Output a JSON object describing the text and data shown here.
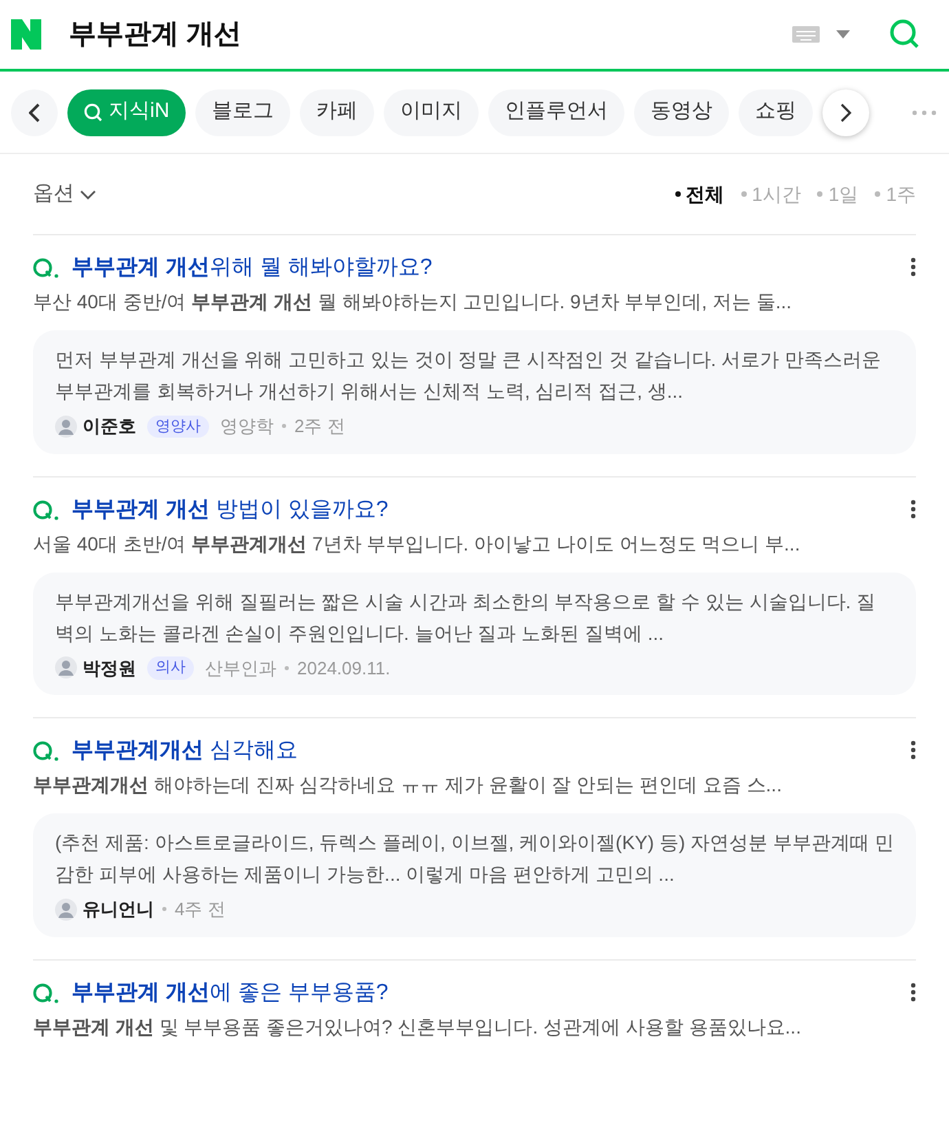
{
  "search": {
    "query": "부부관계 개선"
  },
  "tabs": [
    {
      "label": "지식iN",
      "selected": true
    },
    {
      "label": "블로그",
      "selected": false
    },
    {
      "label": "카페",
      "selected": false
    },
    {
      "label": "이미지",
      "selected": false
    },
    {
      "label": "인플루언서",
      "selected": false
    },
    {
      "label": "동영상",
      "selected": false
    },
    {
      "label": "쇼핑",
      "selected": false
    }
  ],
  "options": {
    "label": "옵션"
  },
  "periods": [
    {
      "label": "전체",
      "selected": true
    },
    {
      "label": "1시간",
      "selected": false
    },
    {
      "label": "1일",
      "selected": false
    },
    {
      "label": "1주",
      "selected": false
    }
  ],
  "results": [
    {
      "title": "**부부관계 개선**위해 뭘 해봐야할까요?",
      "snippet": "부산 40대 중반/여 **부부관계 개선** 뭘 해봐야하는지 고민입니다. 9년차 부부인데, 저는 둘...",
      "answer": {
        "text": "먼저 부부관계 개선을 위해 고민하고 있는 것이 정말 큰 시작점인 것 같습니다. 서로가 만족스러운 부부관계를 회복하거나 개선하기 위해서는 신체적 노력, 심리적 접근, 생...",
        "author": "이준호",
        "badge": "영양사",
        "field": "영양학",
        "time": "2주 전"
      }
    },
    {
      "title": "**부부관계 개선** 방법이 있을까요?",
      "snippet": "서울 40대 초반/여 **부부관계개선** 7년차 부부입니다. 아이낳고 나이도 어느정도 먹으니 부...",
      "answer": {
        "text": "부부관계개선을 위해 질필러는 짧은 시술 시간과 최소한의 부작용으로 할 수 있는 시술입니다. 질 벽의 노화는 콜라겐 손실이 주원인입니다. 늘어난 질과 노화된 질벽에 ...",
        "author": "박정원",
        "badge": "의사",
        "field": "산부인과",
        "time": "2024.09.11."
      }
    },
    {
      "title": "**부부관계개선** 심각해요",
      "snippet": "**부부관계개선** 해야하는데 진짜 심각하네요 ㅠㅠ 제가 윤활이 잘 안되는 편인데 요즘 스...",
      "answer": {
        "text": "(추천 제품: 아스트로글라이드, 듀렉스 플레이, 이브젤, 케이와이젤(KY) 등) 자연성분 부부관계때 민감한 피부에 사용하는 제품이니 가능한... 이렇게 마음 편안하게 고민의 ...",
        "author": "유니언니",
        "time": "4주 전"
      }
    },
    {
      "title": "**부부관계 개선**에 좋은 부부용품?",
      "snippet": "**부부관계 개선** 및 부부용품 좋은거있나여? 신혼부부입니다. 성관계에 사용할 용품있나요..."
    }
  ]
}
